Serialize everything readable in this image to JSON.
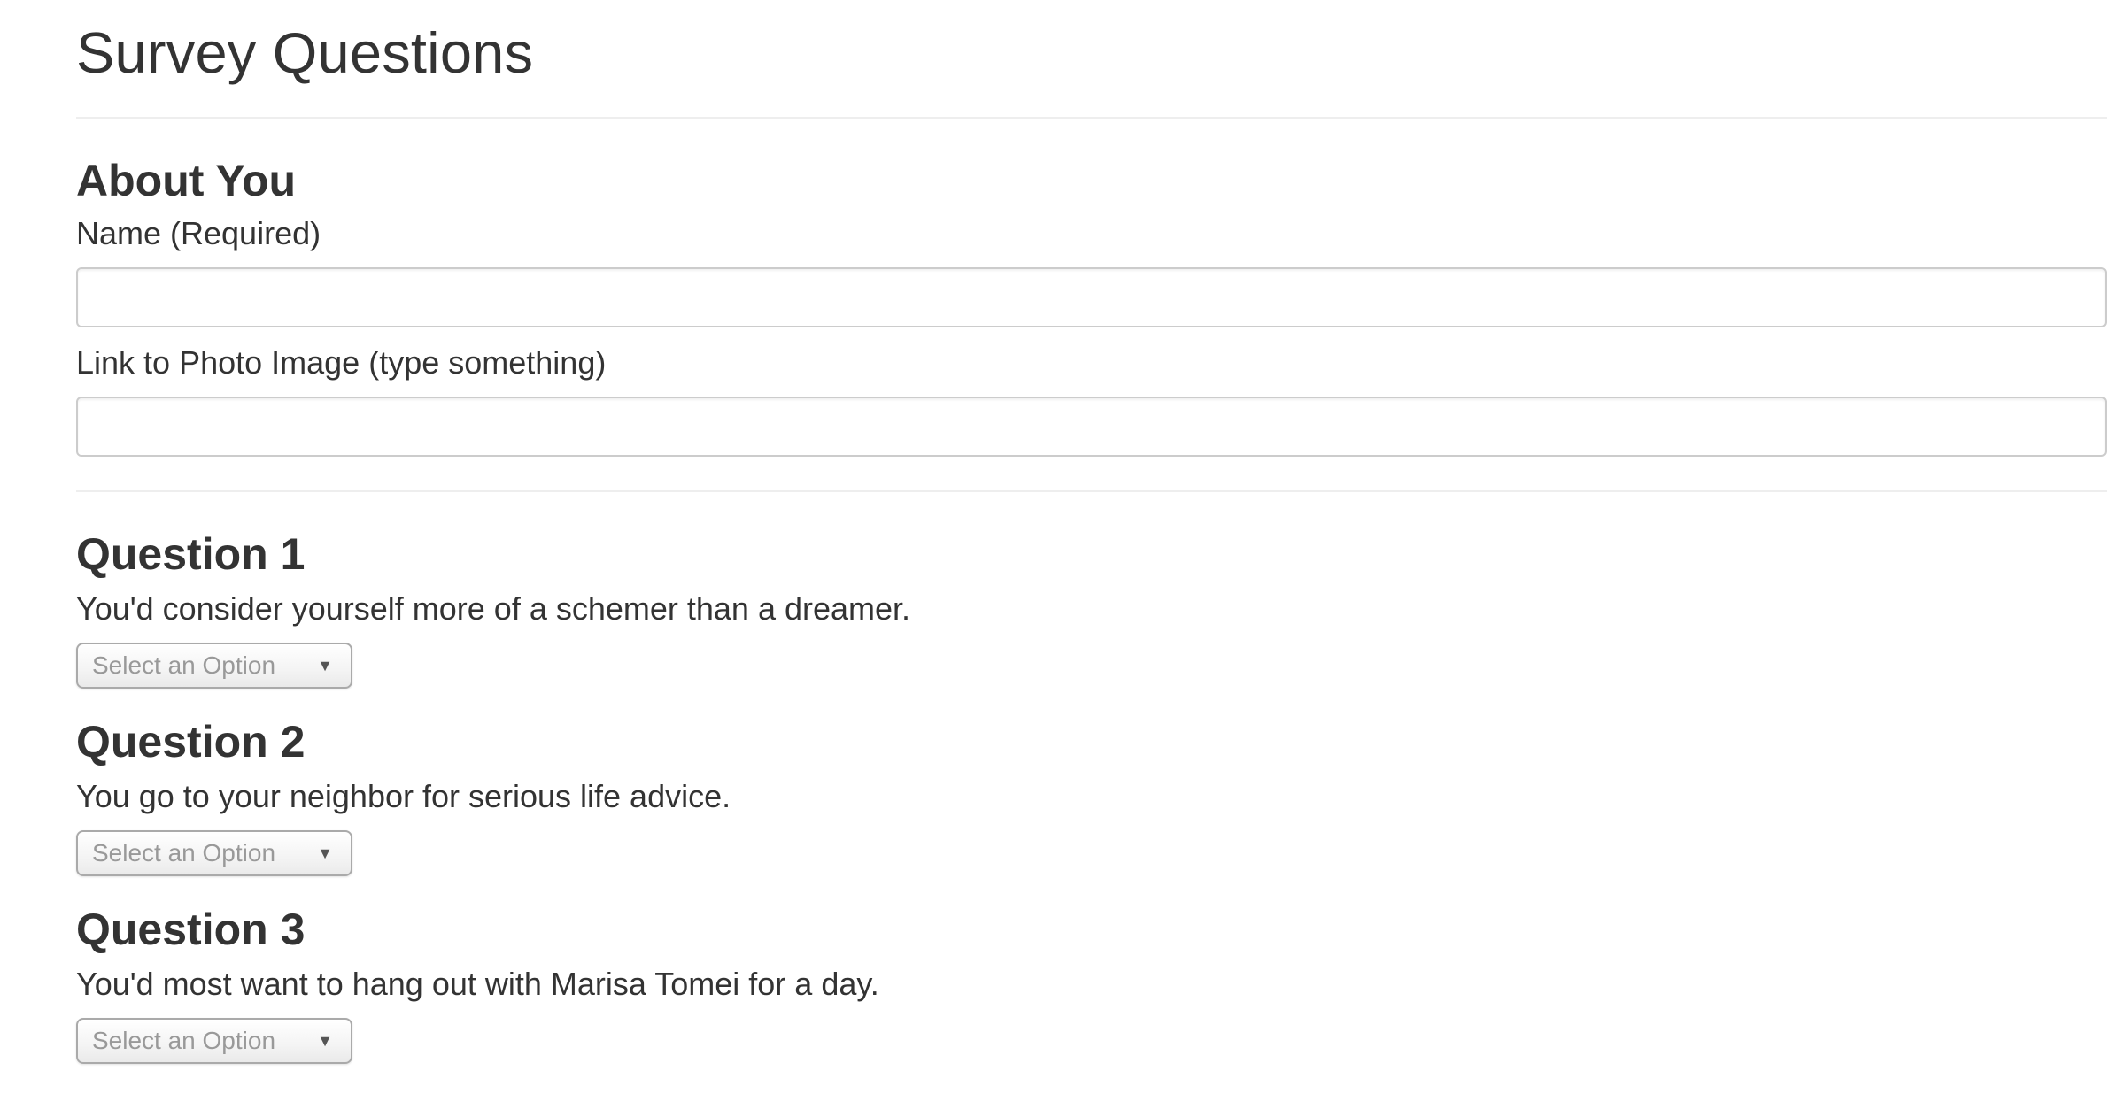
{
  "page": {
    "title": "Survey Questions"
  },
  "about": {
    "heading": "About You",
    "name_label": "Name (Required)",
    "name_value": "",
    "photo_label": "Link to Photo Image (type something)",
    "photo_value": ""
  },
  "questions": [
    {
      "heading": "Question 1",
      "text": "You'd consider yourself more of a schemer than a dreamer.",
      "select_placeholder": "Select an Option"
    },
    {
      "heading": "Question 2",
      "text": "You go to your neighbor for serious life advice.",
      "select_placeholder": "Select an Option"
    },
    {
      "heading": "Question 3",
      "text": "You'd most want to hang out with Marisa Tomei for a day.",
      "select_placeholder": "Select an Option"
    }
  ],
  "icons": {
    "select_arrow": "caret-down-icon"
  },
  "colors": {
    "text": "#333333",
    "rule": "#eeeeee",
    "input_border": "#cccccc",
    "placeholder": "#999999"
  }
}
